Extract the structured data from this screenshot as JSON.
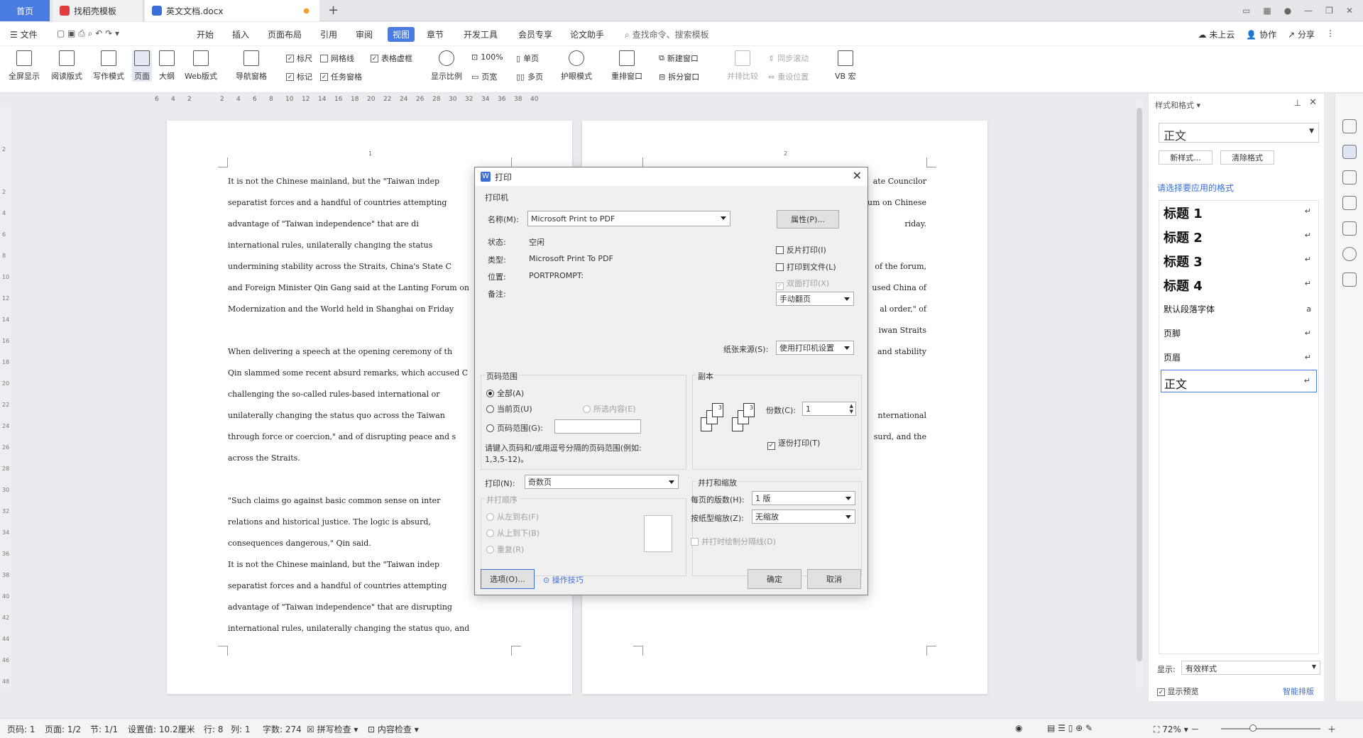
{
  "tabs": {
    "home": "首页",
    "template": "找稻壳模板",
    "doc": "英文文档.docx"
  },
  "menu": {
    "file": "文件",
    "items": [
      "开始",
      "插入",
      "页面布局",
      "引用",
      "审阅",
      "视图",
      "章节",
      "开发工具",
      "会员专享",
      "论文助手"
    ],
    "search": "查找命令、搜索模板",
    "cloud": "未上云",
    "collab": "协作",
    "share": "分享"
  },
  "ribbon": {
    "big": [
      "全屏显示",
      "阅读版式",
      "写作模式",
      "页面",
      "大纲",
      "Web版式"
    ],
    "nav": "导航窗格",
    "checks": [
      {
        "label": "标尺",
        "on": true
      },
      {
        "label": "网格线",
        "on": false
      },
      {
        "label": "表格虚框",
        "on": true
      },
      {
        "label": "标记",
        "on": true
      },
      {
        "label": "任务窗格",
        "on": true
      }
    ],
    "zoom": "显示比例",
    "zoom100": "100%",
    "single": "单页",
    "pagewidth": "页宽",
    "multi": "多页",
    "eye": "护眼模式",
    "rearrange": "重排窗口",
    "newwin": "新建窗口",
    "split": "拆分窗口",
    "compare": "并排比较",
    "sync": "同步滚动",
    "reset": "重设位置",
    "vb": "VB 宏"
  },
  "ruler": [
    "6",
    "4",
    "2",
    "",
    "2",
    "4",
    "6",
    "8",
    "10",
    "12",
    "14",
    "16",
    "18",
    "20",
    "22",
    "24",
    "26",
    "28",
    "30",
    "32",
    "34",
    "36",
    "38",
    "40"
  ],
  "vruler": [
    "2",
    "",
    "2",
    "4",
    "6",
    "8",
    "10",
    "12",
    "14",
    "16",
    "18",
    "20",
    "22",
    "24",
    "26",
    "28",
    "30",
    "32",
    "34",
    "36",
    "38",
    "40",
    "42",
    "44",
    "46",
    "48"
  ],
  "page1": {
    "num": "1",
    "lines": [
      "It is not the Chinese mainland, but the \"Taiwan indep",
      "separatist forces and a handful of countries attempting",
      "advantage  of  \"Taiwan  independence\"  that  are  di",
      "international rules, unilaterally changing the status",
      "undermining stability across the Straits, China's State C",
      "and Foreign Minister Qin Gang said at the Lanting Forum on",
      "Modernization and the World held in Shanghai on Friday",
      "",
      "When delivering a speech at the opening ceremony of th",
      "Qin slammed some recent absurd remarks, which accused C",
      "challenging the so-called rules-based international or",
      "unilaterally changing the status quo across the Taiwan",
      "through force or coercion,\" and of disrupting peace and s",
      "across the Straits.",
      "",
      "\"Such claims go against basic common sense on inter",
      "relations and historical justice. The logic is absurd,",
      "consequences dangerous,\" Qin said.",
      "It is not the Chinese mainland, but the \"Taiwan indep",
      "separatist forces and a handful of countries attempting",
      "advantage  of  \"Taiwan  independence\"  that  are  disrupting",
      "international rules, unilaterally changing the status quo, and"
    ]
  },
  "page2": {
    "num": "2",
    "lines": [
      "ate Councilor",
      "um on Chinese",
      "riday.",
      "",
      "of the forum,",
      "used China of",
      "al order,\" of",
      "iwan Straits",
      "and stability",
      "",
      "",
      "nternational",
      "surd, and the"
    ]
  },
  "panel": {
    "title": "样式和格式",
    "current": "正文",
    "new_style": "新样式...",
    "clear": "清除格式",
    "prompt": "请选择要应用的格式",
    "styles": [
      "标题 1",
      "标题 2",
      "标题 3",
      "标题 4",
      "默认段落字体",
      "页脚",
      "页眉",
      "正文"
    ],
    "show_label": "显示:",
    "show_value": "有效样式",
    "preview": "显示预览",
    "smart": "智能排版"
  },
  "status": {
    "page": "页码: 1",
    "pages": "页面: 1/2",
    "section": "节: 1/1",
    "setting": "设置值: 10.2厘米",
    "row": "行: 8",
    "col": "列: 1",
    "words": "字数: 274",
    "spell": "拼写检查",
    "content": "内容检查",
    "zoom": "72%"
  },
  "dialog": {
    "title": "打印",
    "printer_group": "打印机",
    "name_label": "名称(M):",
    "printer": "Microsoft Print to PDF",
    "props": "属性(P)...",
    "status_label": "状态:",
    "status": "空闲",
    "type_label": "类型:",
    "type": "Microsoft Print To PDF",
    "where_label": "位置:",
    "where": "PORTPROMPT:",
    "comment_label": "备注:",
    "reverse": "反片打印(I)",
    "tofile": "打印到文件(L)",
    "duplex": "双面打印(X)",
    "manual": "手动翻页",
    "source_label": "纸张来源(S):",
    "source": "使用打印机设置",
    "range_group": "页码范围",
    "all": "全部(A)",
    "current": "当前页(U)",
    "selection": "所选内容(E)",
    "range": "页码范围(G):",
    "hint": "请键入页码和/或用逗号分隔的页码范围(例如:",
    "hint2": "1,3,5-12)。",
    "copies_group": "副本",
    "copies_label": "份数(C):",
    "copies": "1",
    "collate": "逐份打印(T)",
    "print_label": "打印(N):",
    "print_value": "奇数页",
    "order_group": "并打顺序",
    "ltr": "从左到右(F)",
    "ttb": "从上到下(B)",
    "repeat": "重复(R)",
    "scale_group": "并打和缩放",
    "perpage_label": "每页的版数(H):",
    "perpage": "1 版",
    "scale_label": "按纸型缩放(Z):",
    "scale": "无缩放",
    "divider": "并打时绘制分隔线(D)",
    "options": "选项(O)...",
    "tips": "操作技巧",
    "ok": "确定",
    "cancel": "取消"
  },
  "colors": {
    "accent": "#4a7be0"
  }
}
